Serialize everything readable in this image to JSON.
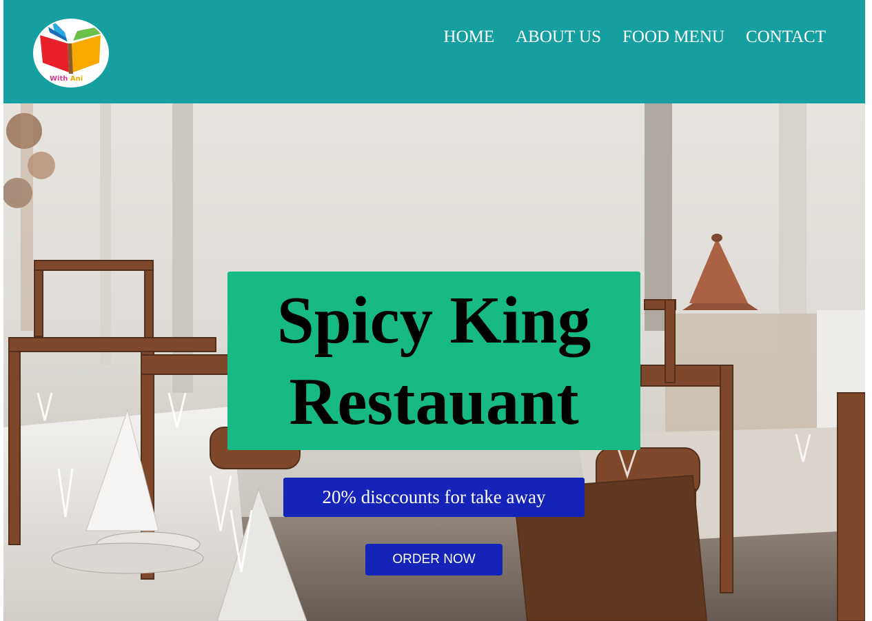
{
  "header": {
    "logo": {
      "icon": "open-book-logo-icon",
      "text_main": "With ",
      "text_accent": "Ani",
      "colors": [
        "#e8202a",
        "#f9a800",
        "#2aa8e0",
        "#6cc04a"
      ]
    },
    "nav": [
      {
        "label": "HOME"
      },
      {
        "label": "ABOUT US"
      },
      {
        "label": "FOOD MENU"
      },
      {
        "label": "CONTACT"
      }
    ],
    "background_color": "#159fa1"
  },
  "hero": {
    "background_image": "restaurant-dining-room-photo",
    "title_line1": "Spicy King",
    "title_line2": "Restauant",
    "title_box_color": "#17b984",
    "promo_text": "20% disccounts for take away",
    "order_button_label": "ORDER NOW",
    "button_color": "#1424b8"
  }
}
